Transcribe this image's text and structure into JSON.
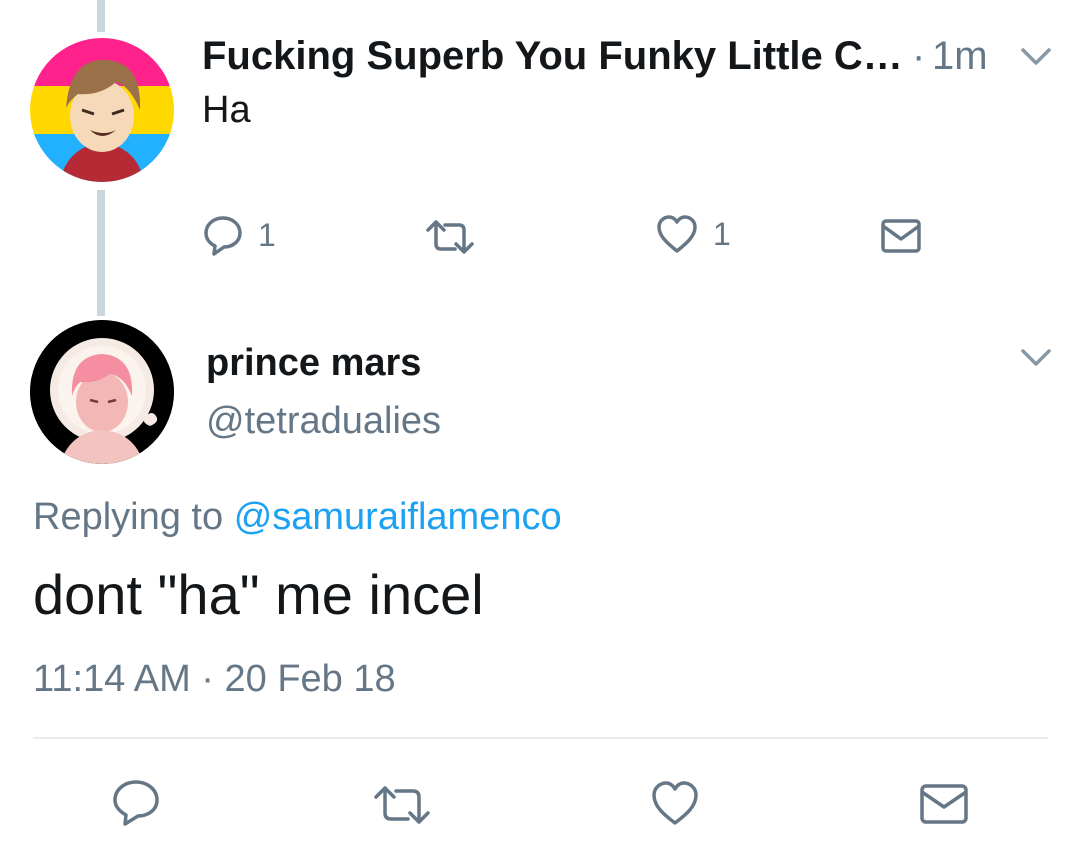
{
  "reply_tweet": {
    "display_name": "Fucking Superb You Funky Little C…",
    "time_separator": "·",
    "time_ago": "1m",
    "text": "Ha",
    "reply_count": "1",
    "like_count": "1",
    "avatar_background_colors": [
      "#ff218c",
      "#ffd800",
      "#21b1ff"
    ]
  },
  "main_tweet": {
    "display_name": "prince mars",
    "handle": "@tetradualies",
    "replying_label": "Replying to",
    "replying_to": "@samuraiflamenco",
    "text": "dont \"ha\" me incel",
    "time": "11:14 AM",
    "date_separator": "·",
    "date": "20 Feb 18"
  },
  "icons": {
    "reply": "reply-icon",
    "retweet": "retweet-icon",
    "like": "heart-icon",
    "dm": "envelope-icon",
    "more": "chevron-down-icon"
  },
  "colors": {
    "text": "#14171a",
    "muted": "#657786",
    "link": "#1da1f2",
    "thread_line": "#ccd6dd",
    "divider": "#e6ecf0"
  }
}
